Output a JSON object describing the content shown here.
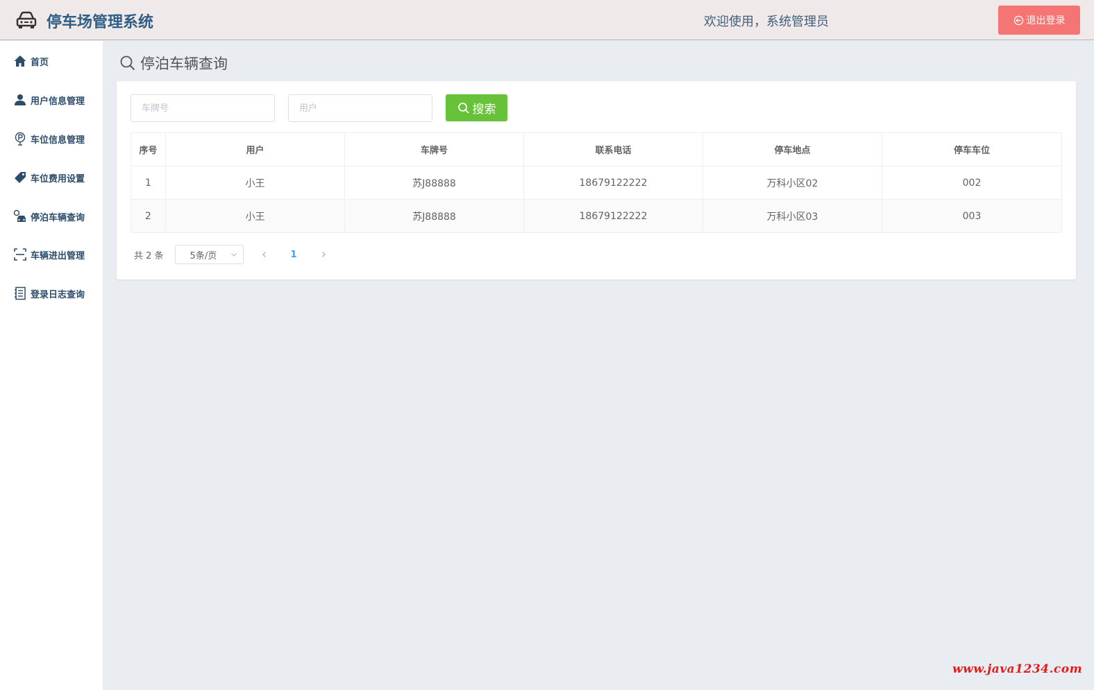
{
  "header": {
    "app_title": "停车场管理系统",
    "welcome": "欢迎使用，系统管理员",
    "logout_label": "退出登录",
    "icons": {
      "logo": "car-icon",
      "logout": "logout-circle-arrow-icon"
    }
  },
  "sidebar": {
    "items": [
      {
        "label": "首页",
        "icon": "home-icon"
      },
      {
        "label": "用户信息管理",
        "icon": "user-icon"
      },
      {
        "label": "车位信息管理",
        "icon": "parking-sign-icon"
      },
      {
        "label": "车位费用设置",
        "icon": "price-tag-icon"
      },
      {
        "label": "停泊车辆查询",
        "icon": "car-search-icon"
      },
      {
        "label": "车辆进出管理",
        "icon": "scan-icon"
      },
      {
        "label": "登录日志查询",
        "icon": "notebook-icon"
      }
    ]
  },
  "main": {
    "page_title": "停泊车辆查询",
    "search": {
      "plate_placeholder": "车牌号",
      "user_placeholder": "用户",
      "button_label": "搜索"
    },
    "table": {
      "columns": [
        "序号",
        "用户",
        "车牌号",
        "联系电话",
        "停车地点",
        "停车车位"
      ],
      "rows": [
        [
          "1",
          "小王",
          "苏J88888",
          "18679122222",
          "万科小区02",
          "002"
        ],
        [
          "2",
          "小王",
          "苏J88888",
          "18679122222",
          "万科小区03",
          "003"
        ]
      ]
    },
    "pagination": {
      "total": "共 2 条",
      "page_size": "5条/页",
      "current_page": "1"
    }
  },
  "watermark": "www.java1234.com",
  "colors": {
    "header_bg": "#efe9e9",
    "title": "#2f5d85",
    "logout": "#f57474",
    "search_button": "#67c23a",
    "active_page": "#409eff",
    "page_bg": "#e9ecf1"
  }
}
